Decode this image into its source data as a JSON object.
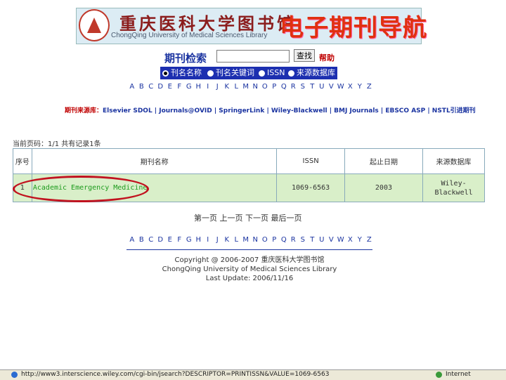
{
  "banner": {
    "library_cn": "重庆医科大学图书馆",
    "library_en": "ChongQing University of Medical Sciences Library",
    "section_title": "电子期刊导航"
  },
  "search": {
    "label": "期刊检索",
    "input_value": "",
    "button_label": "查找",
    "help_label": "帮助"
  },
  "options": [
    {
      "label": "刊名名称",
      "selected": true
    },
    {
      "label": "刊名关键词",
      "selected": false
    },
    {
      "label": "ISSN",
      "selected": false
    },
    {
      "label": "来源数据库",
      "selected": false
    }
  ],
  "letters": [
    "A",
    "B",
    "C",
    "D",
    "E",
    "F",
    "G",
    "H",
    "I",
    "J",
    "K",
    "L",
    "M",
    "N",
    "O",
    "P",
    "Q",
    "R",
    "S",
    "T",
    "U",
    "V",
    "W",
    "X",
    "Y",
    "Z"
  ],
  "sources": {
    "label": "期刊来源库：",
    "value": "Elsevier SDOL | Journals@OVID | SpringerLink | Wiley-Blackwell | BMJ Journals | EBSCO ASP | NSTL引进期刊"
  },
  "page_info": "当前页码：1/1 共有记录1条",
  "table": {
    "headers": [
      "序号",
      "期刊名称",
      "ISSN",
      "起止日期",
      "来源数据库"
    ],
    "rows": [
      {
        "no": "1",
        "title": "Academic Emergency Medicine",
        "issn": "1069-6563",
        "dates": "2003",
        "source": "Wiley-Blackwell"
      }
    ]
  },
  "pagination": {
    "first": "第一页",
    "prev": "上一页",
    "next": "下一页",
    "last": "最后一页"
  },
  "footer": {
    "copyright": "Copyright @ 2006-2007 重庆医科大学图书馆",
    "org": "ChongQing University of Medical Sciences Library",
    "updated": "Last Update: 2006/11/16"
  },
  "statusbar": {
    "url": "http://www3.interscience.wiley.com/cgi-bin/jsearch?DESCRIPTOR=PRINTISSN&VALUE=1069-6563",
    "zone": "Internet"
  }
}
